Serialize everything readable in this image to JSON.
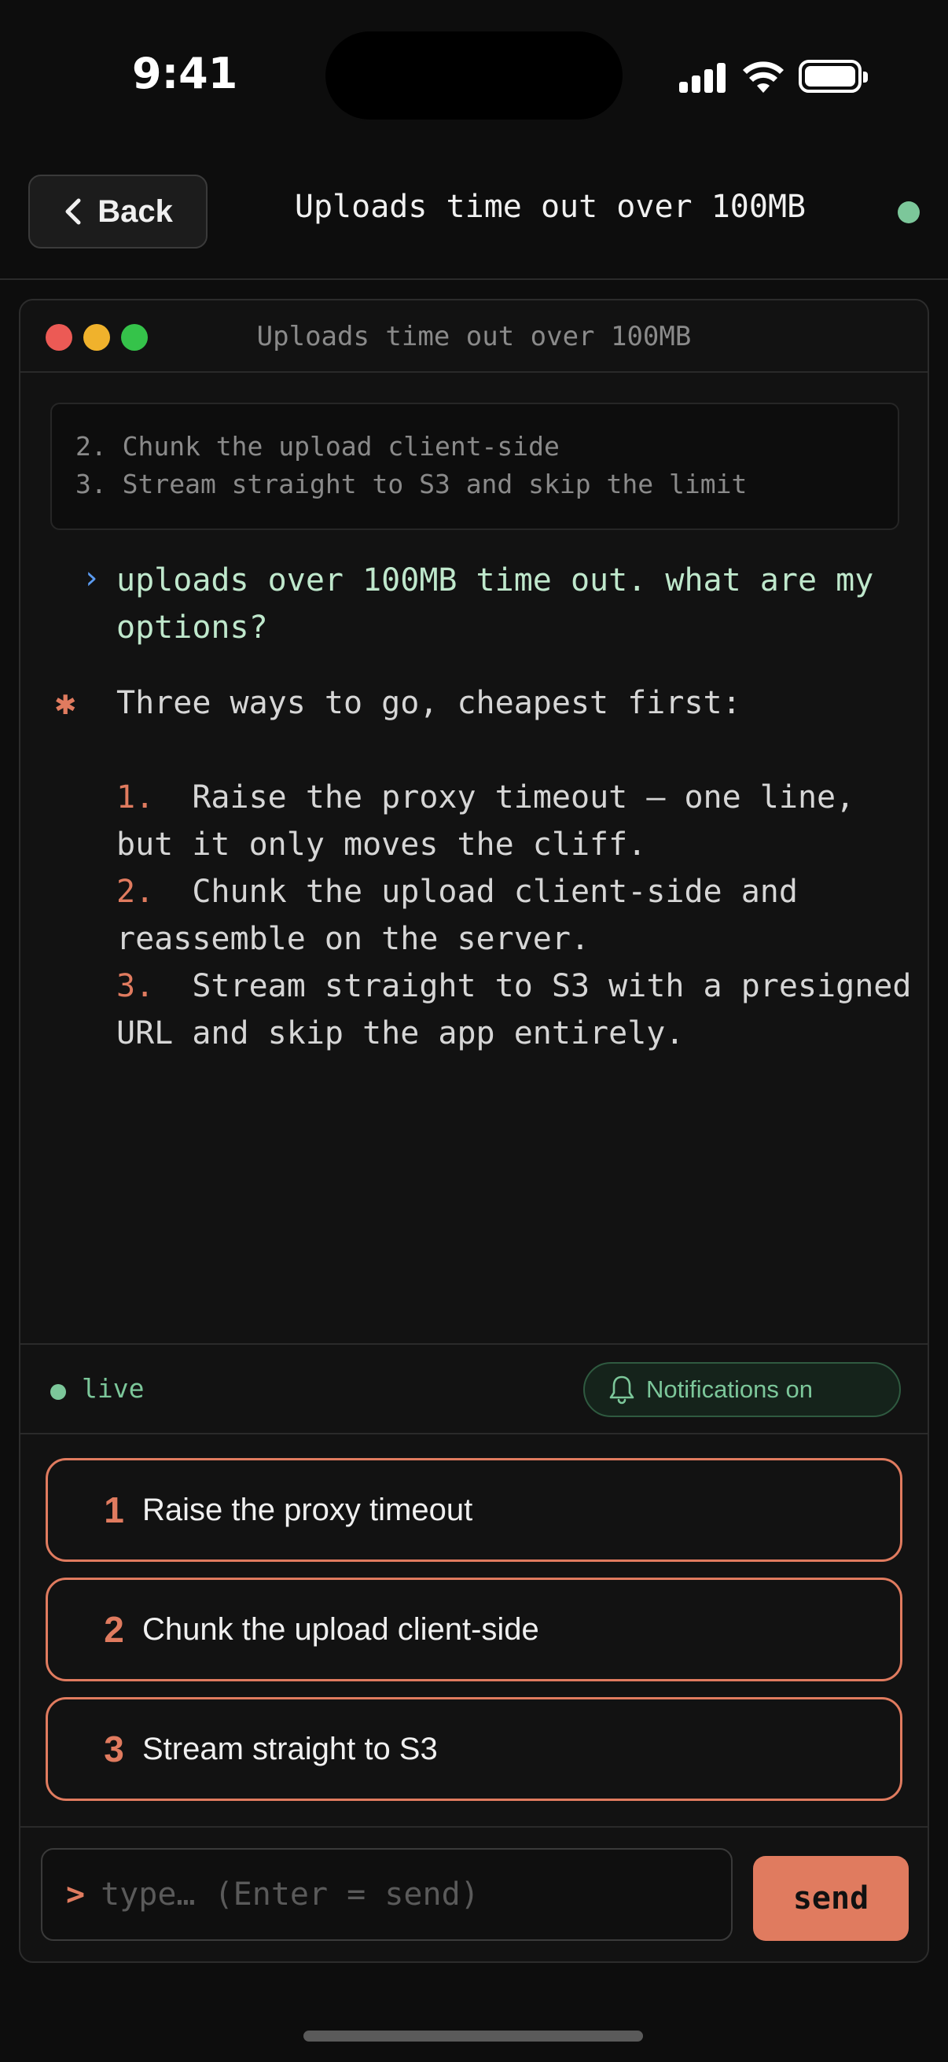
{
  "status_bar": {
    "time": "9:41"
  },
  "header": {
    "back_label": "Back",
    "title": "Uploads time out over 100MB",
    "status_color": "#7cc79a"
  },
  "window": {
    "title": "Uploads time out over 100MB",
    "previous_lines": [
      "2. Chunk the upload client-side",
      "3. Stream straight to S3 and skip the limit"
    ],
    "user_prompt_marker": "›",
    "user_message": "uploads over 100MB time out. what are my options?",
    "assistant_marker": "✱",
    "assistant_intro": "Three ways to go, cheapest first:",
    "assistant_items": [
      {
        "num": "1.",
        "text": "Raise the proxy timeout — one line, but it only moves the cliff."
      },
      {
        "num": "2.",
        "text": "Chunk the upload client-side and reassemble on the server."
      },
      {
        "num": "3.",
        "text": "Stream straight to S3 with a presigned URL and skip the app entirely."
      }
    ]
  },
  "live_bar": {
    "status": "live",
    "notifications_label": "Notifications on"
  },
  "options": [
    {
      "num": "1",
      "label": "Raise the proxy timeout"
    },
    {
      "num": "2",
      "label": "Chunk the upload client-side"
    },
    {
      "num": "3",
      "label": "Stream straight to S3"
    }
  ],
  "composer": {
    "prompt": ">",
    "placeholder": "type… (Enter = send)",
    "value": "",
    "send_label": "send"
  },
  "colors": {
    "accent": "#e07b5f",
    "live_green": "#7cc79a",
    "user_text": "#bfe8cc",
    "prompt_blue": "#5b9bf0"
  }
}
